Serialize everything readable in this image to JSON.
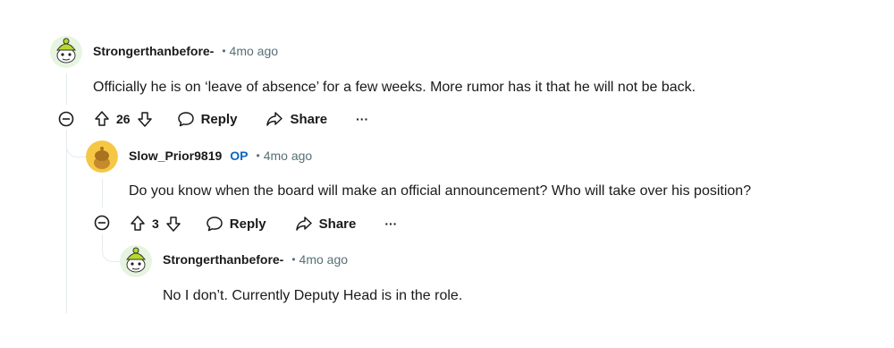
{
  "comments": [
    {
      "author": "Strongerthanbefore-",
      "op_badge": "",
      "separator": "•",
      "time": "4mo ago",
      "text": "Officially he is on ‘leave of absence’ for a few weeks. More rumor has it that he will not be back.",
      "votes": "26",
      "reply_label": "Reply",
      "share_label": "Share",
      "more_label": "···",
      "avatar": "snoo-green-hat"
    },
    {
      "author": "Slow_Prior9819",
      "op_badge": "OP",
      "separator": "•",
      "time": "4mo ago",
      "text": "Do you know when the board will make an official announcement? Who will take over his position?",
      "votes": "3",
      "reply_label": "Reply",
      "share_label": "Share",
      "more_label": "···",
      "avatar": "snoo-yellow"
    },
    {
      "author": "Strongerthanbefore-",
      "op_badge": "",
      "separator": "•",
      "time": "4mo ago",
      "text": "No I don’t. Currently Deputy Head is in the role.",
      "avatar": "snoo-green-hat"
    }
  ],
  "colors": {
    "op": "#0a66c2",
    "meta": "#576f76",
    "thread": "#e5ebee"
  },
  "icons": [
    "upvote-icon",
    "downvote-icon",
    "reply-icon",
    "share-icon",
    "collapse-icon",
    "more-icon"
  ]
}
